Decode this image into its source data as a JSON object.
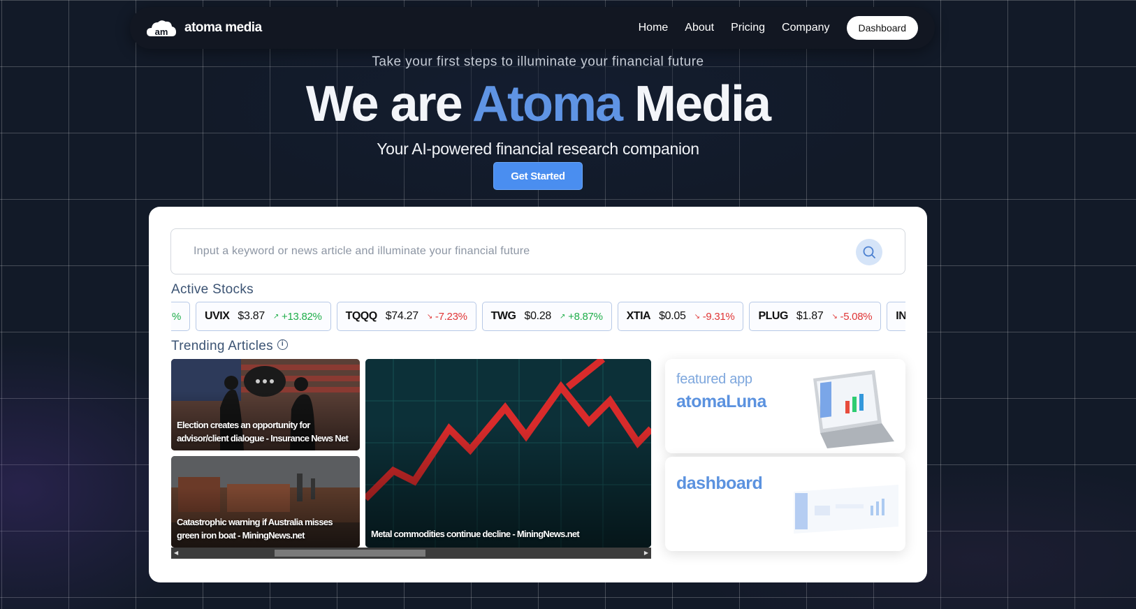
{
  "nav": {
    "logo_text": "am",
    "brand": "atoma media",
    "links": [
      "Home",
      "About",
      "Pricing",
      "Company"
    ],
    "dashboard_label": "Dashboard"
  },
  "hero": {
    "subtitle": "Take your first steps to illuminate your financial future",
    "title_part1": "We are ",
    "title_accent": "Atoma",
    "title_part2": " Media",
    "tagline": "Your AI-powered financial research companion",
    "cta_label": "Get Started"
  },
  "search": {
    "placeholder": "Input a keyword or news article and illuminate your financial future"
  },
  "active_stocks": {
    "label": "Active Stocks",
    "leading_fragment": "%",
    "items": [
      {
        "symbol": "UVIX",
        "price": "$3.87",
        "change": "+13.82%",
        "direction": "up"
      },
      {
        "symbol": "TQQQ",
        "price": "$74.27",
        "change": "-7.23%",
        "direction": "down"
      },
      {
        "symbol": "TWG",
        "price": "$0.28",
        "change": "+8.87%",
        "direction": "up"
      },
      {
        "symbol": "XTIA",
        "price": "$0.05",
        "change": "-9.31%",
        "direction": "down"
      },
      {
        "symbol": "PLUG",
        "price": "$1.87",
        "change": "-5.08%",
        "direction": "down"
      }
    ],
    "trailing_fragment": "IN"
  },
  "trending": {
    "label": "Trending Articles",
    "articles": [
      {
        "title": "Election creates an opportunity for advisor/client dialogue - Insurance News Net"
      },
      {
        "title": "Catastrophic warning if Australia misses green iron boat - MiningNews.net"
      },
      {
        "title": "Metal commodities continue decline - MiningNews.net"
      }
    ]
  },
  "featured": {
    "kicker": "featured app",
    "app_name": "atomaLuna",
    "dashboard_label": "dashboard"
  },
  "colors": {
    "accent": "#5f94e4",
    "cta": "#4a8ef0",
    "up": "#1fae4a",
    "down": "#e03535",
    "background": "#121a28"
  }
}
